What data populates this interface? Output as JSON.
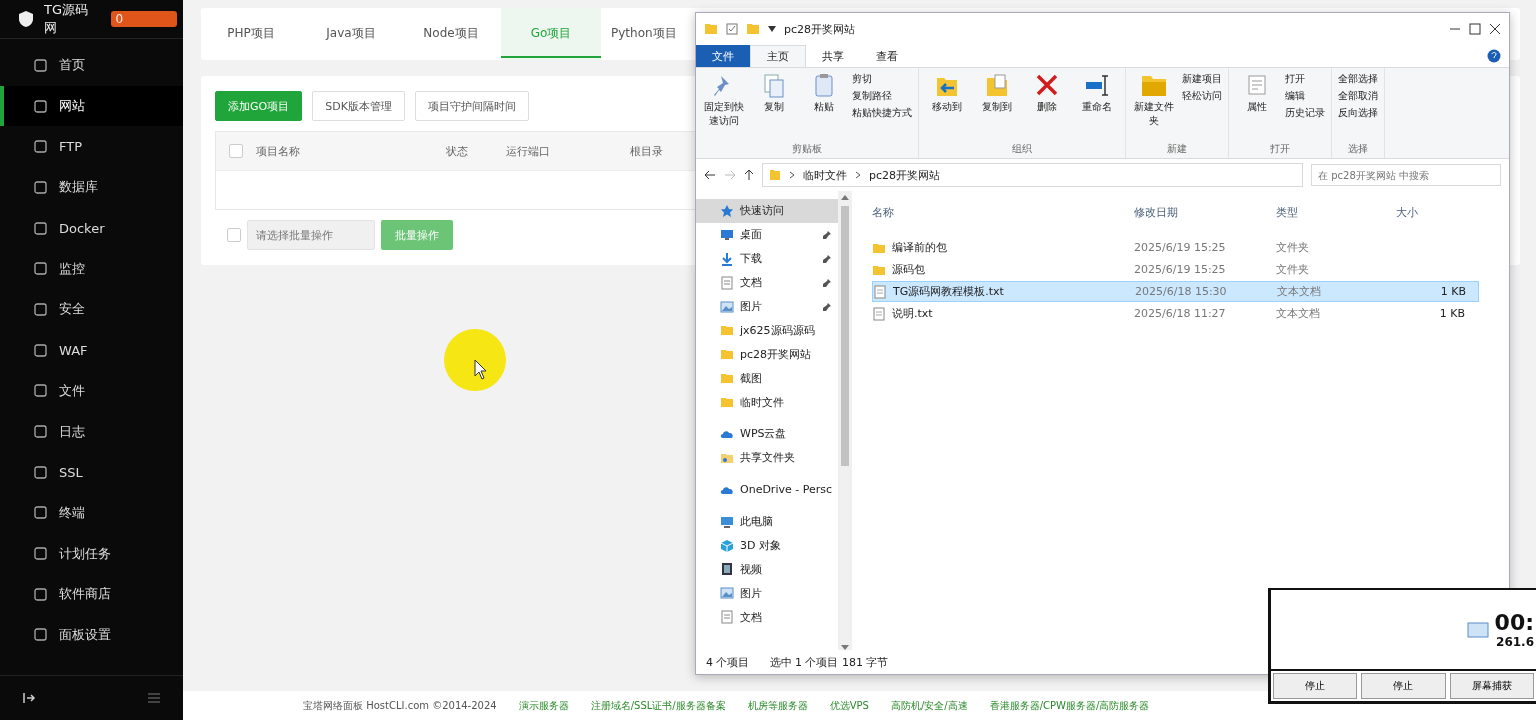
{
  "sidebar": {
    "logo": "TG源码网",
    "badge": "0",
    "items": [
      {
        "label": "首页",
        "selected": false
      },
      {
        "label": "网站",
        "selected": true
      },
      {
        "label": "FTP",
        "selected": false
      },
      {
        "label": "数据库",
        "selected": false
      },
      {
        "label": "Docker",
        "selected": false
      },
      {
        "label": "监控",
        "selected": false
      },
      {
        "label": "安全",
        "selected": false
      },
      {
        "label": "WAF",
        "selected": false
      },
      {
        "label": "文件",
        "selected": false
      },
      {
        "label": "日志",
        "selected": false
      },
      {
        "label": "SSL",
        "selected": false
      },
      {
        "label": "终端",
        "selected": false
      },
      {
        "label": "计划任务",
        "selected": false
      },
      {
        "label": "软件商店",
        "selected": false
      },
      {
        "label": "面板设置",
        "selected": false
      }
    ]
  },
  "tabs": [
    {
      "label": "PHP项目",
      "selected": false
    },
    {
      "label": "Java项目",
      "selected": false
    },
    {
      "label": "Node项目",
      "selected": false
    },
    {
      "label": "Go项目",
      "selected": true
    },
    {
      "label": "Python项目",
      "selected": false
    }
  ],
  "toolbar": [
    {
      "label": "添加GO项目",
      "kind": "primary"
    },
    {
      "label": "SDK版本管理",
      "kind": "default"
    },
    {
      "label": "项目守护间隔时间",
      "kind": "default"
    }
  ],
  "table": {
    "columns": [
      "项目名称",
      "状态",
      "运行端口",
      "根目录"
    ],
    "all_checked": false
  },
  "batch": {
    "checked": false,
    "placeholder": "请选择批量操作",
    "button": "批量操作"
  },
  "footer": [
    "宝塔网络面板 HostCLI.com ©2014-2024",
    "演示服务器",
    "注册域名/SSL证书/服务器备案",
    "机房等服务器",
    "优选VPS",
    "高防机/安全/高速",
    "香港服务器/CPW服务器/高防服务器"
  ],
  "explorer": {
    "title": "pc28开奖网站",
    "ribbon_tabs": [
      {
        "label": "文件",
        "kind": "file",
        "selected": false
      },
      {
        "label": "主页",
        "kind": "tab",
        "selected": true
      },
      {
        "label": "共享",
        "kind": "tab",
        "selected": false
      },
      {
        "label": "查看",
        "kind": "tab",
        "selected": false
      }
    ],
    "groups": [
      {
        "name": "剪贴板",
        "big": [
          {
            "label": "固定到快速访问",
            "kind": "pin"
          },
          {
            "label": "复制",
            "kind": "copy"
          },
          {
            "label": "粘贴",
            "kind": "paste"
          }
        ],
        "small": [
          "剪切",
          "复制路径",
          "粘贴快捷方式"
        ]
      },
      {
        "name": "组织",
        "big": [
          {
            "label": "移动到",
            "kind": "move"
          },
          {
            "label": "复制到",
            "kind": "copyto"
          },
          {
            "label": "删除",
            "kind": "delete"
          },
          {
            "label": "重命名",
            "kind": "rename"
          }
        ]
      },
      {
        "name": "新建",
        "big": [
          {
            "label": "新建文件夹",
            "kind": "folder"
          }
        ],
        "small": [
          "新建项目",
          "轻松访问"
        ]
      },
      {
        "name": "打开",
        "big": [
          {
            "label": "属性",
            "kind": "props"
          }
        ],
        "small": [
          "打开",
          "编辑",
          "历史记录"
        ]
      },
      {
        "name": "选择",
        "small": [
          "全部选择",
          "全部取消",
          "反向选择"
        ]
      }
    ],
    "path": [
      "临时文件",
      "pc28开奖网站"
    ],
    "search": {
      "placeholder": "在 pc28开奖网站 中搜索"
    },
    "columns": [
      "名称",
      "修改日期",
      "类型",
      "大小"
    ],
    "nav": [
      {
        "label": "快速访问",
        "kind": "star",
        "pinned": false,
        "selected": true
      },
      {
        "label": "桌面",
        "kind": "desktop",
        "pinned": true,
        "selected": false
      },
      {
        "label": "下载",
        "kind": "download",
        "pinned": true,
        "selected": false
      },
      {
        "label": "文档",
        "kind": "doc",
        "pinned": true,
        "selected": false
      },
      {
        "label": "图片",
        "kind": "image",
        "pinned": true,
        "selected": false
      },
      {
        "label": "jx625源码源码",
        "kind": "folder",
        "pinned": false,
        "selected": false
      },
      {
        "label": "pc28开奖网站",
        "kind": "folder",
        "pinned": false,
        "selected": false
      },
      {
        "label": "截图",
        "kind": "folder",
        "pinned": false,
        "selected": false
      },
      {
        "label": "临时文件",
        "kind": "folder",
        "pinned": false,
        "selected": false
      },
      {
        "label": "WPS云盘",
        "kind": "cloud",
        "pinned": false,
        "selected": false
      },
      {
        "label": "共享文件夹",
        "kind": "share",
        "pinned": false,
        "selected": false
      },
      {
        "label": "OneDrive - Persc",
        "kind": "cloud",
        "pinned": false,
        "selected": false
      },
      {
        "label": "此电脑",
        "kind": "pc",
        "pinned": false,
        "selected": false
      },
      {
        "label": "3D 对象",
        "kind": "cube",
        "pinned": false,
        "selected": false
      },
      {
        "label": "视频",
        "kind": "video",
        "pinned": false,
        "selected": false
      },
      {
        "label": "图片",
        "kind": "image",
        "pinned": false,
        "selected": false
      },
      {
        "label": "文档",
        "kind": "doc",
        "pinned": false,
        "selected": false
      }
    ],
    "files": [
      {
        "name": "编译前的包",
        "date": "2025/6/19 15:25",
        "type": "文件夹",
        "kind": "folder",
        "selected": false
      },
      {
        "name": "源码包",
        "date": "2025/6/19 15:25",
        "type": "文件夹",
        "kind": "folder",
        "selected": false
      },
      {
        "name": "TG源码网教程模板.txt",
        "date": "2025/6/18 15:30",
        "type": "文本文档",
        "size": "1 KB",
        "kind": "text",
        "selected": true
      },
      {
        "name": "说明.txt",
        "date": "2025/6/18 11:27",
        "type": "文本文档",
        "size": "1 KB",
        "kind": "text",
        "selected": false
      }
    ],
    "status": [
      "4 个项目",
      "选中 1 个项目 181 字节"
    ]
  },
  "recorder": {
    "time": "00:",
    "size": "261.6",
    "buttons": [
      "停止",
      "停止",
      "屏幕捕获"
    ]
  }
}
